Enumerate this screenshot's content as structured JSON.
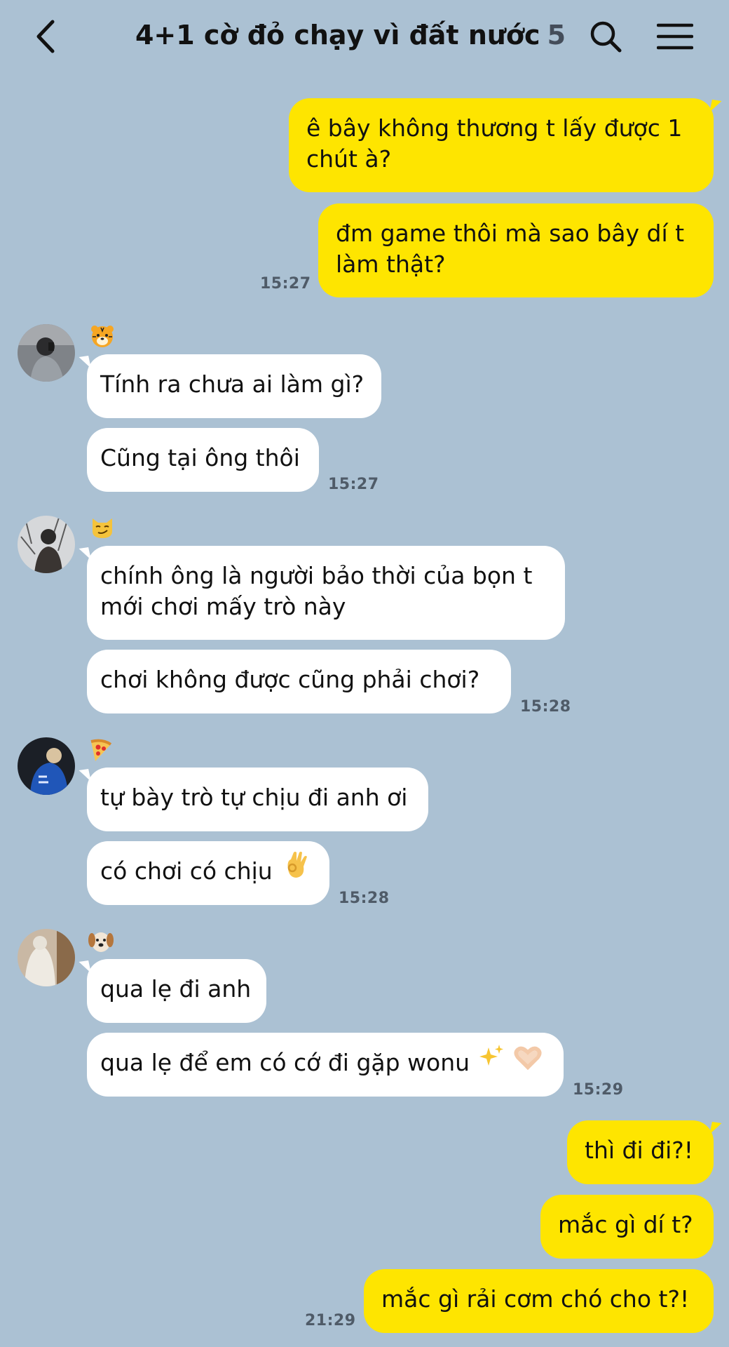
{
  "header": {
    "title": "4+1 cờ đỏ chạy vì đất nước",
    "member_count": "5",
    "back_icon": "chevron-left-icon",
    "search_icon": "search-icon",
    "menu_icon": "hamburger-menu-icon"
  },
  "colors": {
    "background": "#abc1d3",
    "outgoing_bubble": "#fee500",
    "incoming_bubble": "#ffffff",
    "timestamp": "#4f5b68"
  },
  "messages": [
    {
      "direction": "out",
      "lines": [
        "ê bây không thương t lấy được 1",
        "chút à?"
      ]
    },
    {
      "direction": "out",
      "lines": [
        "đm game thôi mà sao bây dí t",
        "làm thật?"
      ],
      "time": "15:27"
    },
    {
      "sender_emoji": "tiger-emoji",
      "direction": "in",
      "text": "Tính ra chưa ai làm gì?"
    },
    {
      "direction": "in",
      "text": "Cũng tại ông thôi",
      "time": "15:27"
    },
    {
      "sender_emoji": "smirking-cat-emoji",
      "direction": "in",
      "lines": [
        "chính ông là người bảo thời của bọn t",
        "mới chơi mấy trò này"
      ]
    },
    {
      "direction": "in",
      "text": "chơi không được cũng phải chơi?",
      "time": "15:28"
    },
    {
      "sender_emoji": "pizza-emoji",
      "direction": "in",
      "text": "tự bày trò tự chịu đi anh ơi"
    },
    {
      "direction": "in",
      "text": "có chơi có chịu",
      "emoji": "ok-hand-emoji",
      "time": "15:28"
    },
    {
      "sender_emoji": "dog-emoji",
      "direction": "in",
      "text": "qua lẹ đi anh"
    },
    {
      "direction": "in",
      "text": "qua lẹ để em có cớ đi gặp wonu",
      "emoji": "sparkles-heart-hands-emoji",
      "time": "15:29"
    },
    {
      "direction": "out",
      "text": "thì đi đi?!"
    },
    {
      "direction": "out",
      "text": "mắc gì dí t?"
    },
    {
      "direction": "out",
      "text": "mắc gì rải cơm chó cho t?!",
      "time": "21:29"
    }
  ]
}
